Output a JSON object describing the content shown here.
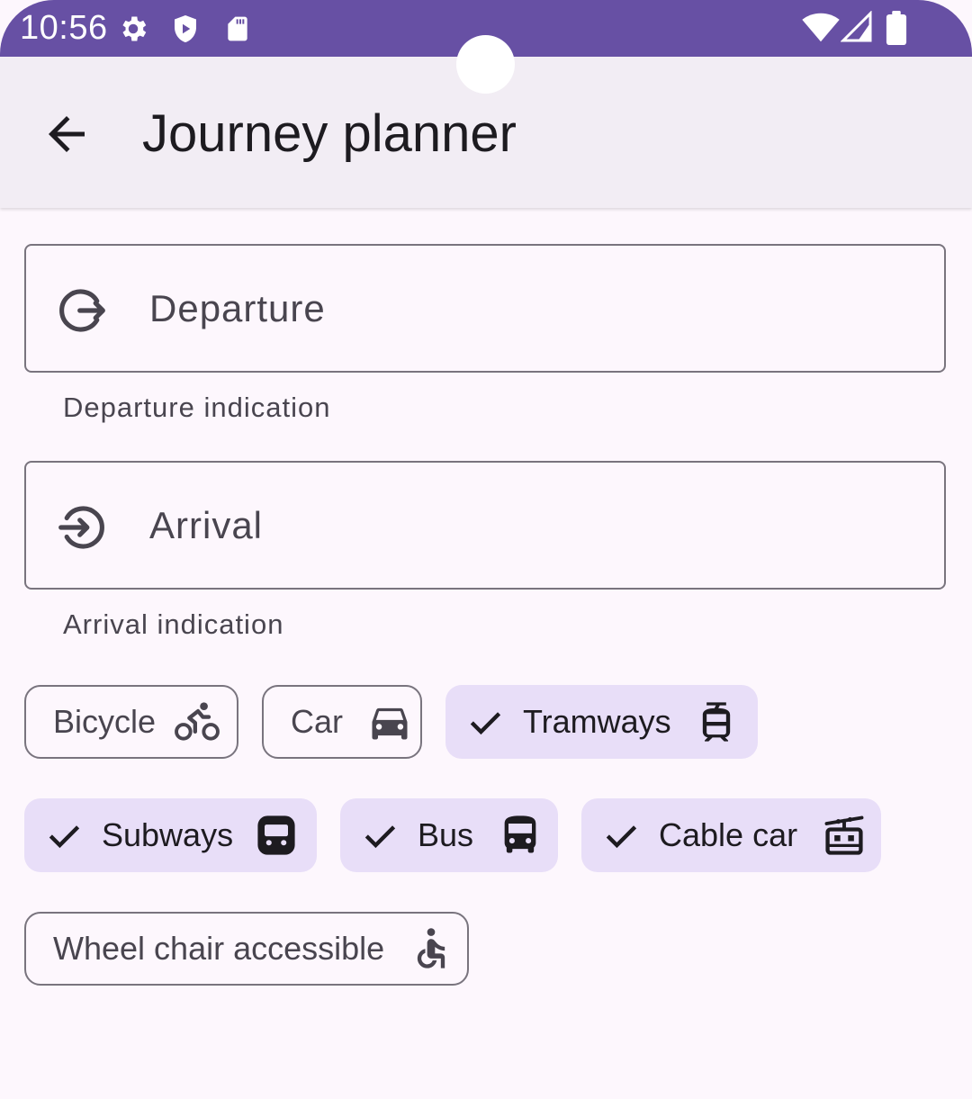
{
  "status_bar": {
    "time": "10:56",
    "icons": [
      "settings-icon",
      "shield-icon",
      "sd-card-icon",
      "wifi-icon",
      "signal-icon",
      "battery-icon"
    ]
  },
  "app_bar": {
    "back_icon": "arrow-back-icon",
    "title": "Journey planner"
  },
  "departure": {
    "icon": "logout-icon",
    "label": "Departure",
    "helper": "Departure indication"
  },
  "arrival": {
    "icon": "login-icon",
    "label": "Arrival",
    "helper": "Arrival indication"
  },
  "chips": {
    "bicycle": {
      "label": "Bicycle",
      "selected": false,
      "icon": "bicycle-icon"
    },
    "car": {
      "label": "Car",
      "selected": false,
      "icon": "car-icon"
    },
    "tramways": {
      "label": "Tramways",
      "selected": true,
      "icon": "tram-icon"
    },
    "subways": {
      "label": "Subways",
      "selected": true,
      "icon": "subway-icon"
    },
    "bus": {
      "label": "Bus",
      "selected": true,
      "icon": "bus-icon"
    },
    "cable_car": {
      "label": "Cable car",
      "selected": true,
      "icon": "cable-car-icon"
    },
    "wheelchair": {
      "label": "Wheel chair accessible",
      "selected": false,
      "icon": "wheelchair-icon"
    }
  },
  "colors": {
    "status_bar": "#6750a4",
    "app_bar": "#f2edf4",
    "background": "#fdf7fd",
    "chip_selected": "#e8def8",
    "outline": "#79747e"
  }
}
